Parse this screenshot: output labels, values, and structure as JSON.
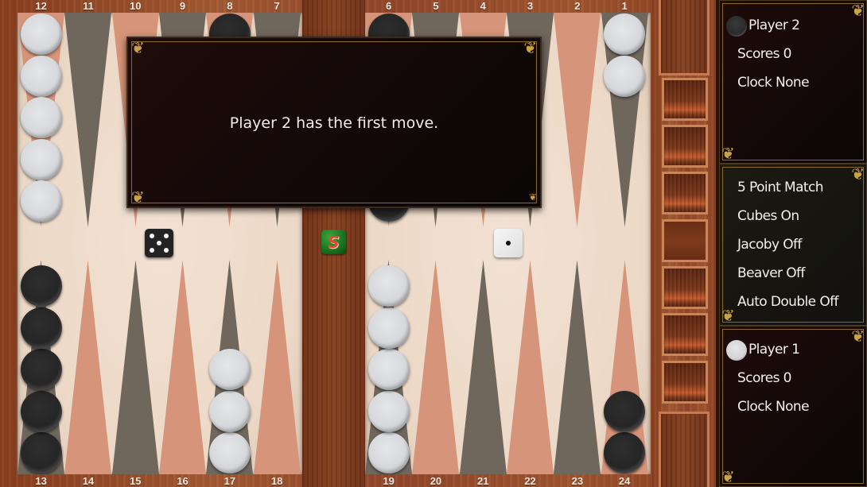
{
  "game": "Backgammon",
  "dialog": {
    "message": "Player 2 has the first move."
  },
  "players": {
    "player2": {
      "name": "Player 2",
      "checker_color": "dark",
      "scores": "Scores 0",
      "clock": "Clock None"
    },
    "player1": {
      "name": "Player 1",
      "checker_color": "white",
      "scores": "Scores 0",
      "clock": "Clock None"
    }
  },
  "options": [
    "5 Point Match",
    "Cubes On",
    "Jacoby Off",
    "Beaver Off",
    "Auto Double Off"
  ],
  "dice": [
    {
      "owner": "player2",
      "color": "black",
      "value": 5
    },
    {
      "owner": "player1",
      "color": "white",
      "value": 1
    }
  ],
  "doubling_cube": {
    "label": "S"
  },
  "board": {
    "top_labels": [
      "12",
      "11",
      "10",
      "9",
      "8",
      "7",
      "6",
      "5",
      "4",
      "3",
      "2",
      "1"
    ],
    "bottom_labels": [
      "13",
      "14",
      "15",
      "16",
      "17",
      "18",
      "19",
      "20",
      "21",
      "22",
      "23",
      "24"
    ],
    "top_point_colors": [
      "salmon",
      "dark",
      "salmon",
      "dark",
      "salmon",
      "dark",
      "salmon",
      "dark",
      "salmon",
      "dark",
      "salmon",
      "dark"
    ],
    "bottom_point_colors": [
      "dark",
      "salmon",
      "dark",
      "salmon",
      "dark",
      "salmon",
      "dark",
      "salmon",
      "dark",
      "salmon",
      "dark",
      "salmon"
    ],
    "points": [
      {
        "point": 12,
        "color": "white",
        "count": 5
      },
      {
        "point": 8,
        "color": "dark",
        "count": 3
      },
      {
        "point": 6,
        "color": "dark",
        "count": 5
      },
      {
        "point": 1,
        "color": "white",
        "count": 2
      },
      {
        "point": 13,
        "color": "dark",
        "count": 5
      },
      {
        "point": 17,
        "color": "white",
        "count": 3
      },
      {
        "point": 19,
        "color": "white",
        "count": 5
      },
      {
        "point": 24,
        "color": "dark",
        "count": 2
      }
    ]
  },
  "colors": {
    "point_dark": "#6f665c",
    "point_salmon": "#d6947a",
    "felt": "#efdccb",
    "gold": "#c9a344"
  }
}
